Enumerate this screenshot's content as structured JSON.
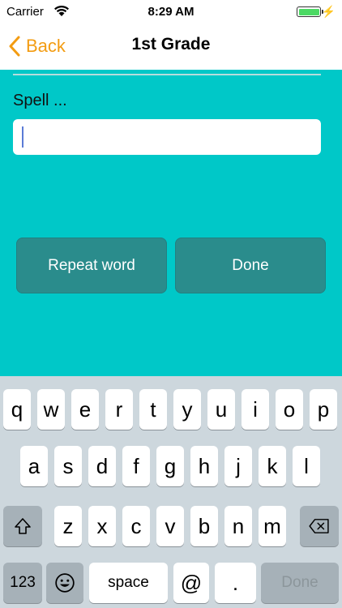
{
  "status": {
    "carrier": "Carrier",
    "time": "8:29 AM"
  },
  "nav": {
    "back_label": "Back",
    "title": "1st Grade"
  },
  "main": {
    "prompt": "Spell ...",
    "answer_value": "",
    "repeat_label": "Repeat word",
    "done_label": "Done"
  },
  "keyboard": {
    "row1": [
      "q",
      "w",
      "e",
      "r",
      "t",
      "y",
      "u",
      "i",
      "o",
      "p"
    ],
    "row2": [
      "a",
      "s",
      "d",
      "f",
      "g",
      "h",
      "j",
      "k",
      "l"
    ],
    "row3": [
      "z",
      "x",
      "c",
      "v",
      "b",
      "n",
      "m"
    ],
    "numbers_label": "123",
    "space_label": "space",
    "at_label": "@",
    "dot_label": ".",
    "done_label": "Done"
  },
  "colors": {
    "background": "#00c8c8",
    "button": "#2a8c8c",
    "accent": "#f39c12",
    "battery": "#4cd964"
  }
}
